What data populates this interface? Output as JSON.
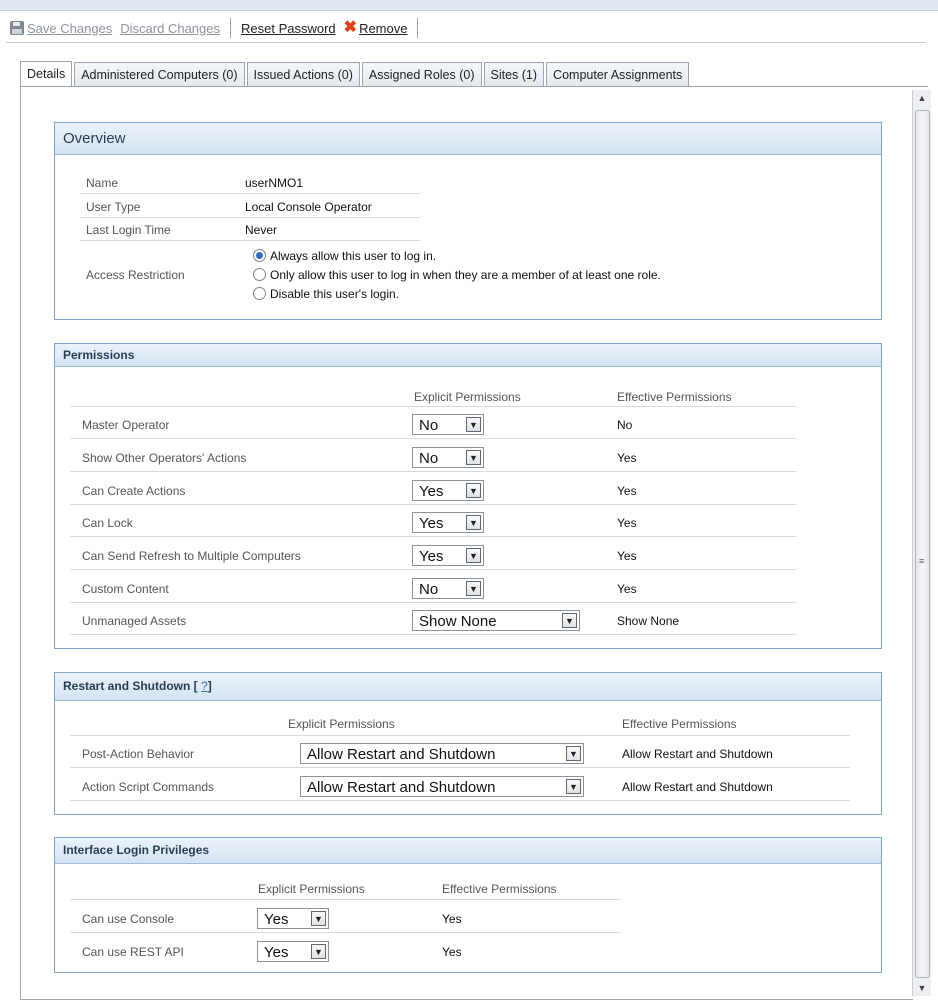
{
  "toolbar": {
    "save_changes": "Save Changes",
    "discard_changes": "Discard Changes",
    "reset_password": "Reset Password",
    "remove": "Remove"
  },
  "tabs": [
    {
      "label": "Details"
    },
    {
      "label": "Administered Computers (0)"
    },
    {
      "label": "Issued Actions (0)"
    },
    {
      "label": "Assigned Roles (0)"
    },
    {
      "label": "Sites (1)"
    },
    {
      "label": "Computer Assignments"
    }
  ],
  "overview": {
    "title": "Overview",
    "name_label": "Name",
    "name_value": "userNMO1",
    "user_type_label": "User Type",
    "user_type_value": "Local Console Operator",
    "last_login_label": "Last Login Time",
    "last_login_value": "Never",
    "access_label": "Access Restriction",
    "access_options": [
      "Always allow this user to log in.",
      "Only allow this user to log in when they are a member of at least one role.",
      "Disable this user's login."
    ],
    "access_selected": 0
  },
  "permissions": {
    "title": "Permissions",
    "col_explicit": "Explicit Permissions",
    "col_effective": "Effective Permissions",
    "rows": [
      {
        "label": "Master Operator",
        "explicit": "No",
        "effective": "No"
      },
      {
        "label": "Show Other Operators' Actions",
        "explicit": "No",
        "effective": "Yes"
      },
      {
        "label": "Can Create Actions",
        "explicit": "Yes",
        "effective": "Yes"
      },
      {
        "label": "Can Lock",
        "explicit": "Yes",
        "effective": "Yes"
      },
      {
        "label": "Can Send Refresh to Multiple Computers",
        "explicit": "Yes",
        "effective": "Yes"
      },
      {
        "label": "Custom Content",
        "explicit": "No",
        "effective": "Yes"
      },
      {
        "label": "Unmanaged Assets",
        "explicit": "Show None",
        "effective": "Show None"
      }
    ]
  },
  "restart": {
    "title": "Restart and Shutdown [",
    "help_link": "?",
    "title_end": "]",
    "col_explicit": "Explicit Permissions",
    "col_effective": "Effective Permissions",
    "rows": [
      {
        "label": "Post-Action Behavior",
        "explicit": "Allow Restart and Shutdown",
        "effective": "Allow Restart and Shutdown"
      },
      {
        "label": "Action Script Commands",
        "explicit": "Allow Restart and Shutdown",
        "effective": "Allow Restart and Shutdown"
      }
    ]
  },
  "interface": {
    "title": "Interface Login Privileges",
    "col_explicit": "Explicit Permissions",
    "col_effective": "Effective Permissions",
    "rows": [
      {
        "label": "Can use Console",
        "explicit": "Yes",
        "effective": "Yes"
      },
      {
        "label": "Can use REST API",
        "explicit": "Yes",
        "effective": "Yes"
      }
    ]
  }
}
